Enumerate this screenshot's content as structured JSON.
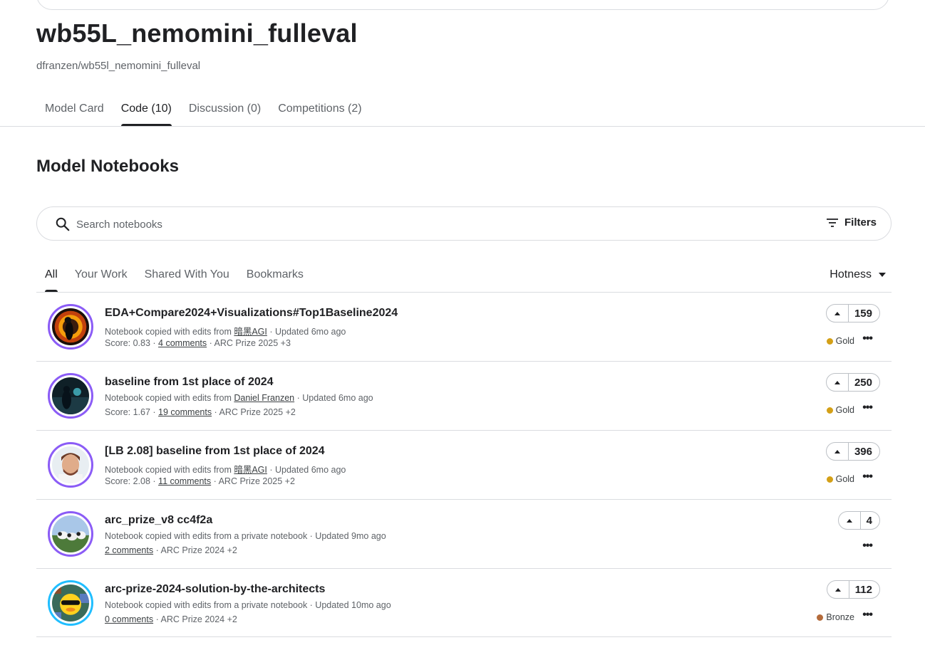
{
  "model": {
    "title": "wb55L_nemomini_fulleval",
    "slug": "dfranzen/wb55l_nemomini_fulleval"
  },
  "tabs": [
    {
      "label": "Model Card",
      "active": false
    },
    {
      "label": "Code (10)",
      "active": true
    },
    {
      "label": "Discussion (0)",
      "active": false
    },
    {
      "label": "Competitions (2)",
      "active": false
    }
  ],
  "section_title": "Model Notebooks",
  "search": {
    "placeholder": "Search notebooks",
    "icon": "search-icon",
    "filters_label": "Filters",
    "filters_icon": "filter-lines-icon"
  },
  "subtabs": [
    {
      "label": "All",
      "active": true
    },
    {
      "label": "Your Work",
      "active": false
    },
    {
      "label": "Shared With You",
      "active": false
    },
    {
      "label": "Bookmarks",
      "active": false
    }
  ],
  "sort": {
    "label": "Hotness",
    "icon": "caret-down-icon"
  },
  "colors": {
    "gold": "#d4a017",
    "bronze": "#b46b3b",
    "avatar_ring_purple": "#8b5cf6",
    "avatar_ring_blue": "#20beff",
    "text": "#202124",
    "muted": "#5f6368"
  },
  "notebooks": [
    {
      "title": "EDA+Compare2024+Visualizations#Top1Baseline2024",
      "meta_prefix": "Notebook copied with edits from ",
      "meta_author": "暗黑AGI",
      "meta_suffix": " · Updated 6mo ago",
      "score": "Score: 0.83 · ",
      "comments": "4 comments",
      "tags": " · ARC Prize 2025 +3",
      "votes": "159",
      "medal": "Gold"
    },
    {
      "title": "baseline from 1st place of 2024",
      "meta_prefix": "Notebook copied with edits from ",
      "meta_author": "Daniel Franzen",
      "meta_suffix": " · Updated 6mo ago",
      "score": "Score: 1.67 · ",
      "comments": "19 comments",
      "tags": " · ARC Prize 2025 +2",
      "votes": "250",
      "medal": "Gold"
    },
    {
      "title": "[LB 2.08] baseline from 1st place of 2024",
      "meta_prefix": "Notebook copied with edits from ",
      "meta_author": "暗黑AGI",
      "meta_suffix": " · Updated 6mo ago",
      "score": "Score: 2.08 · ",
      "comments": "11 comments",
      "tags": " · ARC Prize 2025 +2",
      "votes": "396",
      "medal": "Gold"
    },
    {
      "title": "arc_prize_v8 cc4f2a",
      "meta_prefix": "Notebook copied with edits from a private notebook",
      "meta_author": "",
      "meta_suffix": " · Updated 9mo ago",
      "score": "",
      "comments": "2 comments",
      "tags": " · ARC Prize 2024 +2",
      "votes": "4",
      "medal": ""
    },
    {
      "title": "arc-prize-2024-solution-by-the-architects",
      "meta_prefix": "Notebook copied with edits from a private notebook",
      "meta_author": "",
      "meta_suffix": " · Updated 10mo ago",
      "score": "",
      "comments": "0 comments",
      "tags": " · ARC Prize 2024 +2",
      "votes": "112",
      "medal": "Bronze"
    }
  ],
  "row_icons": {
    "upvote": "caret-up-icon",
    "more": "more-horizontal-icon",
    "medal": "medal-dot-icon"
  }
}
